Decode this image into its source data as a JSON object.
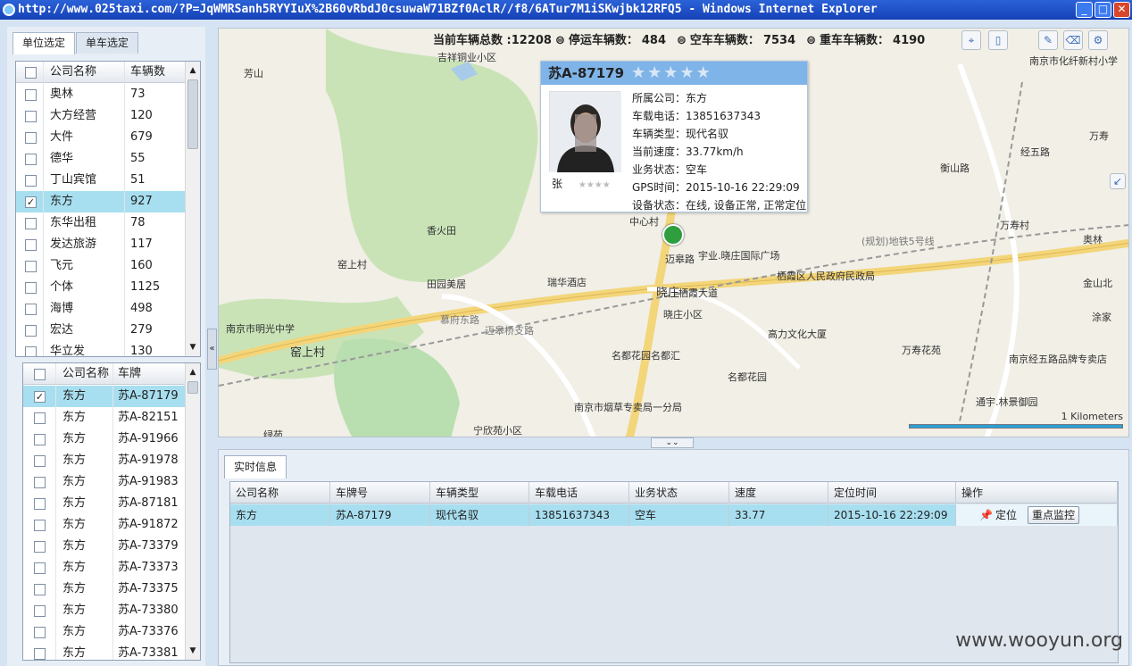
{
  "window": {
    "title": "http://www.025taxi.com/?P=JqWMRSanh5RYYIuX%2B60vRbdJ0csuwaW71BZf0AclR//f8/6ATur7M1iSKwjbk12RFQ5 - Windows Internet Explorer"
  },
  "left": {
    "tabs": [
      "单位选定",
      "单车选定"
    ],
    "company_list": {
      "headers": [
        "公司名称",
        "车辆数"
      ],
      "rows": [
        {
          "name": "奥林",
          "count": "73",
          "checked": false
        },
        {
          "name": "大方经营",
          "count": "120",
          "checked": false
        },
        {
          "name": "大件",
          "count": "679",
          "checked": false
        },
        {
          "name": "德华",
          "count": "55",
          "checked": false
        },
        {
          "name": "丁山宾馆",
          "count": "51",
          "checked": false
        },
        {
          "name": "东方",
          "count": "927",
          "checked": true
        },
        {
          "name": "东华出租",
          "count": "78",
          "checked": false
        },
        {
          "name": "发达旅游",
          "count": "117",
          "checked": false
        },
        {
          "name": "飞元",
          "count": "160",
          "checked": false
        },
        {
          "name": "个体",
          "count": "1125",
          "checked": false
        },
        {
          "name": "海博",
          "count": "498",
          "checked": false
        },
        {
          "name": "宏达",
          "count": "279",
          "checked": false
        },
        {
          "name": "华立发",
          "count": "130",
          "checked": false
        }
      ]
    },
    "vehicle_list": {
      "headers": [
        "公司名称",
        "车牌"
      ],
      "rows": [
        {
          "company": "东方",
          "plate": "苏A-87179",
          "checked": true
        },
        {
          "company": "东方",
          "plate": "苏A-82151",
          "checked": false
        },
        {
          "company": "东方",
          "plate": "苏A-91966",
          "checked": false
        },
        {
          "company": "东方",
          "plate": "苏A-91978",
          "checked": false
        },
        {
          "company": "东方",
          "plate": "苏A-91983",
          "checked": false
        },
        {
          "company": "东方",
          "plate": "苏A-87181",
          "checked": false
        },
        {
          "company": "东方",
          "plate": "苏A-91872",
          "checked": false
        },
        {
          "company": "东方",
          "plate": "苏A-73379",
          "checked": false
        },
        {
          "company": "东方",
          "plate": "苏A-73373",
          "checked": false
        },
        {
          "company": "东方",
          "plate": "苏A-73375",
          "checked": false
        },
        {
          "company": "东方",
          "plate": "苏A-73380",
          "checked": false
        },
        {
          "company": "东方",
          "plate": "苏A-73376",
          "checked": false
        },
        {
          "company": "东方",
          "plate": "苏A-73381",
          "checked": false
        }
      ]
    }
  },
  "map": {
    "stats": {
      "total": "当前车辆总数 :12208",
      "stopped_label": "停运车辆数：",
      "stopped": "484",
      "empty_label": "空车车辆数：",
      "empty": "7534",
      "heavy_label": "重车车辆数：",
      "heavy": "4190"
    },
    "labels": [
      "芳山",
      "吉祥铜业小区",
      "南京市化纤新村小学",
      "万寿",
      "衡山路",
      "经五路",
      "万寿村",
      "奥林",
      "中心村",
      "宇业.晓庄国际广场",
      "香火田",
      "窑上村",
      "田园美居",
      "瑞华酒店",
      "晓庄",
      "晓庄小区",
      "栖霞区人民政府民政局",
      "金山北",
      "涂家",
      "南京市明光中学",
      "窑上村",
      "高力文化大厦",
      "万寿花苑",
      "名都花园名都汇",
      "名都花园",
      "南京经五路品牌专卖店",
      "通宇.林景御园",
      "南京市烟草专卖局一分局",
      "宁欣苑小区",
      "绿苑",
      "慕府东路",
      "迈皋桥支路",
      "栖霞大道",
      "迈皋路",
      "(规划)地铁5号线"
    ],
    "popup": {
      "plate": "苏A-87179",
      "stars": "★★★★★",
      "driver_stars": "★★★★",
      "driver": "张",
      "company": "所属公司：东方",
      "phone": "车载电话：13851637343",
      "type": "车辆类型：现代名驭",
      "speed": "当前速度：33.77km/h",
      "status": "业务状态：空车",
      "gps_time": "GPS时间：2015-10-16 22:29:09",
      "device": "设备状态：在线, 设备正常, 正常定位"
    },
    "scale_label": "1 Kilometers"
  },
  "bottom": {
    "tab": "实时信息",
    "headers": [
      "公司名称",
      "车牌号",
      "车辆类型",
      "车载电话",
      "业务状态",
      "速度",
      "定位时间",
      "操作"
    ],
    "row": {
      "company": "东方",
      "plate": "苏A-87179",
      "type": "现代名驭",
      "phone": "13851637343",
      "status": "空车",
      "speed": "33.77",
      "time": "2015-10-16 22:29:09",
      "locate_label": "定位",
      "monitor_label": "重点监控"
    }
  },
  "watermark": "www.wooyun.org"
}
